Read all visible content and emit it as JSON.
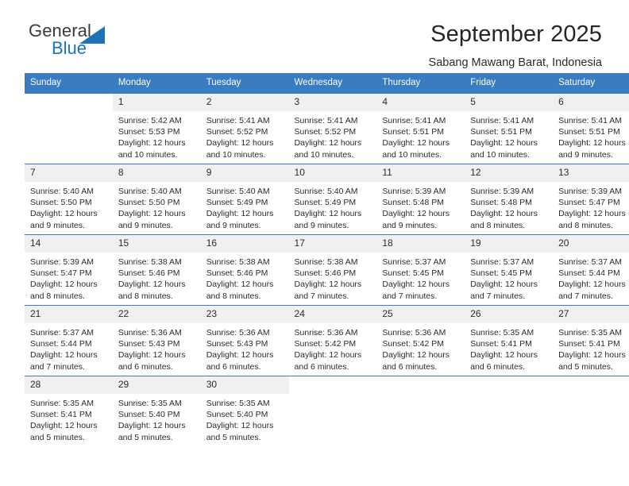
{
  "brand": {
    "word1": "General",
    "word2": "Blue",
    "triangle_color": "#1d72ba",
    "word1_color": "#3b3b3b",
    "word2_color": "#1d72ba"
  },
  "header": {
    "title": "September 2025",
    "subtitle": "Sabang Mawang Barat, Indonesia",
    "accent_color": "#3a7cc0"
  },
  "weekdays": [
    "Sunday",
    "Monday",
    "Tuesday",
    "Wednesday",
    "Thursday",
    "Friday",
    "Saturday"
  ],
  "weeks": [
    [
      {
        "day": "",
        "lines": []
      },
      {
        "day": "1",
        "lines": [
          "Sunrise: 5:42 AM",
          "Sunset: 5:53 PM",
          "Daylight: 12 hours",
          "and 10 minutes."
        ]
      },
      {
        "day": "2",
        "lines": [
          "Sunrise: 5:41 AM",
          "Sunset: 5:52 PM",
          "Daylight: 12 hours",
          "and 10 minutes."
        ]
      },
      {
        "day": "3",
        "lines": [
          "Sunrise: 5:41 AM",
          "Sunset: 5:52 PM",
          "Daylight: 12 hours",
          "and 10 minutes."
        ]
      },
      {
        "day": "4",
        "lines": [
          "Sunrise: 5:41 AM",
          "Sunset: 5:51 PM",
          "Daylight: 12 hours",
          "and 10 minutes."
        ]
      },
      {
        "day": "5",
        "lines": [
          "Sunrise: 5:41 AM",
          "Sunset: 5:51 PM",
          "Daylight: 12 hours",
          "and 10 minutes."
        ]
      },
      {
        "day": "6",
        "lines": [
          "Sunrise: 5:41 AM",
          "Sunset: 5:51 PM",
          "Daylight: 12 hours",
          "and 9 minutes."
        ]
      }
    ],
    [
      {
        "day": "7",
        "lines": [
          "Sunrise: 5:40 AM",
          "Sunset: 5:50 PM",
          "Daylight: 12 hours",
          "and 9 minutes."
        ]
      },
      {
        "day": "8",
        "lines": [
          "Sunrise: 5:40 AM",
          "Sunset: 5:50 PM",
          "Daylight: 12 hours",
          "and 9 minutes."
        ]
      },
      {
        "day": "9",
        "lines": [
          "Sunrise: 5:40 AM",
          "Sunset: 5:49 PM",
          "Daylight: 12 hours",
          "and 9 minutes."
        ]
      },
      {
        "day": "10",
        "lines": [
          "Sunrise: 5:40 AM",
          "Sunset: 5:49 PM",
          "Daylight: 12 hours",
          "and 9 minutes."
        ]
      },
      {
        "day": "11",
        "lines": [
          "Sunrise: 5:39 AM",
          "Sunset: 5:48 PM",
          "Daylight: 12 hours",
          "and 9 minutes."
        ]
      },
      {
        "day": "12",
        "lines": [
          "Sunrise: 5:39 AM",
          "Sunset: 5:48 PM",
          "Daylight: 12 hours",
          "and 8 minutes."
        ]
      },
      {
        "day": "13",
        "lines": [
          "Sunrise: 5:39 AM",
          "Sunset: 5:47 PM",
          "Daylight: 12 hours",
          "and 8 minutes."
        ]
      }
    ],
    [
      {
        "day": "14",
        "lines": [
          "Sunrise: 5:39 AM",
          "Sunset: 5:47 PM",
          "Daylight: 12 hours",
          "and 8 minutes."
        ]
      },
      {
        "day": "15",
        "lines": [
          "Sunrise: 5:38 AM",
          "Sunset: 5:46 PM",
          "Daylight: 12 hours",
          "and 8 minutes."
        ]
      },
      {
        "day": "16",
        "lines": [
          "Sunrise: 5:38 AM",
          "Sunset: 5:46 PM",
          "Daylight: 12 hours",
          "and 8 minutes."
        ]
      },
      {
        "day": "17",
        "lines": [
          "Sunrise: 5:38 AM",
          "Sunset: 5:46 PM",
          "Daylight: 12 hours",
          "and 7 minutes."
        ]
      },
      {
        "day": "18",
        "lines": [
          "Sunrise: 5:37 AM",
          "Sunset: 5:45 PM",
          "Daylight: 12 hours",
          "and 7 minutes."
        ]
      },
      {
        "day": "19",
        "lines": [
          "Sunrise: 5:37 AM",
          "Sunset: 5:45 PM",
          "Daylight: 12 hours",
          "and 7 minutes."
        ]
      },
      {
        "day": "20",
        "lines": [
          "Sunrise: 5:37 AM",
          "Sunset: 5:44 PM",
          "Daylight: 12 hours",
          "and 7 minutes."
        ]
      }
    ],
    [
      {
        "day": "21",
        "lines": [
          "Sunrise: 5:37 AM",
          "Sunset: 5:44 PM",
          "Daylight: 12 hours",
          "and 7 minutes."
        ]
      },
      {
        "day": "22",
        "lines": [
          "Sunrise: 5:36 AM",
          "Sunset: 5:43 PM",
          "Daylight: 12 hours",
          "and 6 minutes."
        ]
      },
      {
        "day": "23",
        "lines": [
          "Sunrise: 5:36 AM",
          "Sunset: 5:43 PM",
          "Daylight: 12 hours",
          "and 6 minutes."
        ]
      },
      {
        "day": "24",
        "lines": [
          "Sunrise: 5:36 AM",
          "Sunset: 5:42 PM",
          "Daylight: 12 hours",
          "and 6 minutes."
        ]
      },
      {
        "day": "25",
        "lines": [
          "Sunrise: 5:36 AM",
          "Sunset: 5:42 PM",
          "Daylight: 12 hours",
          "and 6 minutes."
        ]
      },
      {
        "day": "26",
        "lines": [
          "Sunrise: 5:35 AM",
          "Sunset: 5:41 PM",
          "Daylight: 12 hours",
          "and 6 minutes."
        ]
      },
      {
        "day": "27",
        "lines": [
          "Sunrise: 5:35 AM",
          "Sunset: 5:41 PM",
          "Daylight: 12 hours",
          "and 5 minutes."
        ]
      }
    ],
    [
      {
        "day": "28",
        "lines": [
          "Sunrise: 5:35 AM",
          "Sunset: 5:41 PM",
          "Daylight: 12 hours",
          "and 5 minutes."
        ]
      },
      {
        "day": "29",
        "lines": [
          "Sunrise: 5:35 AM",
          "Sunset: 5:40 PM",
          "Daylight: 12 hours",
          "and 5 minutes."
        ]
      },
      {
        "day": "30",
        "lines": [
          "Sunrise: 5:35 AM",
          "Sunset: 5:40 PM",
          "Daylight: 12 hours",
          "and 5 minutes."
        ]
      },
      {
        "day": "",
        "lines": []
      },
      {
        "day": "",
        "lines": []
      },
      {
        "day": "",
        "lines": []
      },
      {
        "day": "",
        "lines": []
      }
    ]
  ]
}
